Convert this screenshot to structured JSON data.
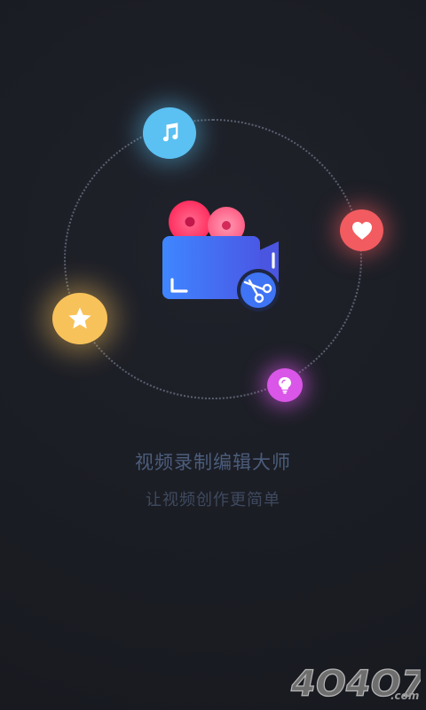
{
  "splash": {
    "title": "视频录制编辑大师",
    "subtitle": "让视频创作更简单"
  },
  "watermark": {
    "text": "4O4O7",
    "suffix": ".com"
  },
  "icons": {
    "center": "video-camera-scissors-icon",
    "top": "music-note-icon",
    "right": "heart-icon",
    "left": "star-icon",
    "bottom": "bulb-icon"
  },
  "colors": {
    "background": "#1b1d24",
    "music": "#5bc0f2",
    "heart": "#f25b5f",
    "star": "#f8c25a",
    "bulb": "#d956e8",
    "camera_body": "#3b7cf6",
    "reel": "#ff3f6b",
    "title": "#4b5d7b"
  }
}
